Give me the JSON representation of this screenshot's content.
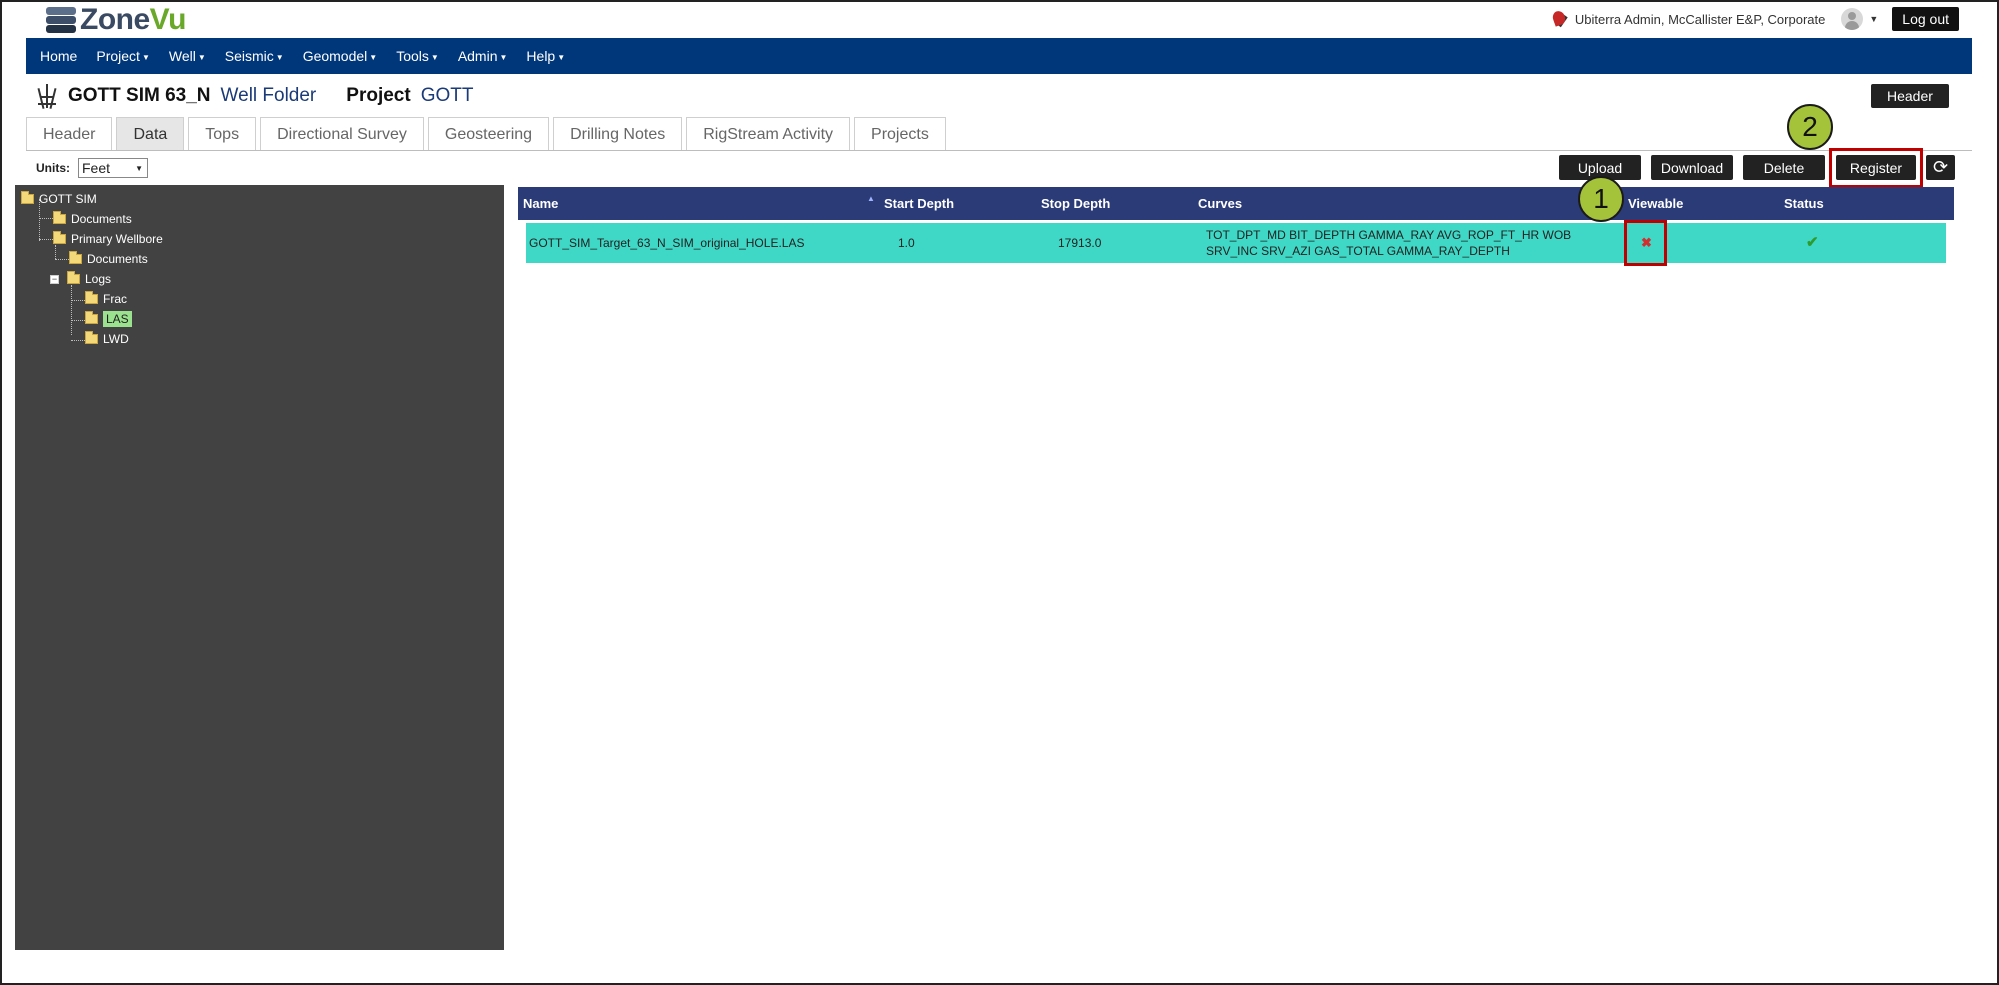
{
  "app": {
    "logo_zone": "Zone",
    "logo_vu": "Vu"
  },
  "user": {
    "name": "Ubiterra Admin, McCallister E&P, Corporate",
    "logout_label": "Log out"
  },
  "nav": {
    "items": [
      {
        "label": "Home",
        "dropdown": false
      },
      {
        "label": "Project",
        "dropdown": true
      },
      {
        "label": "Well",
        "dropdown": true
      },
      {
        "label": "Seismic",
        "dropdown": true
      },
      {
        "label": "Geomodel",
        "dropdown": true
      },
      {
        "label": "Tools",
        "dropdown": true
      },
      {
        "label": "Admin",
        "dropdown": true
      },
      {
        "label": "Help",
        "dropdown": true
      }
    ]
  },
  "title": {
    "well_name": "GOTT SIM 63_N",
    "well_folder": "Well Folder",
    "project_label": "Project",
    "project_name": "GOTT",
    "header_button": "Header"
  },
  "tabs": [
    {
      "label": "Header",
      "active": false
    },
    {
      "label": "Data",
      "active": true
    },
    {
      "label": "Tops",
      "active": false
    },
    {
      "label": "Directional Survey",
      "active": false
    },
    {
      "label": "Geosteering",
      "active": false
    },
    {
      "label": "Drilling Notes",
      "active": false
    },
    {
      "label": "RigStream Activity",
      "active": false
    },
    {
      "label": "Projects",
      "active": false
    }
  ],
  "units": {
    "label": "Units:",
    "selected": "Feet"
  },
  "actions": {
    "upload": "Upload",
    "download": "Download",
    "delete": "Delete",
    "register": "Register",
    "refresh_icon": "refresh-icon"
  },
  "callouts": {
    "one": "1",
    "two": "2"
  },
  "tree": {
    "root": "GOTT SIM",
    "documents": "Documents",
    "primary_wellbore": "Primary Wellbore",
    "wb_documents": "Documents",
    "logs": "Logs",
    "frac": "Frac",
    "las": "LAS",
    "lwd": "LWD"
  },
  "table": {
    "columns": [
      "Name",
      "Start Depth",
      "Stop Depth",
      "Curves",
      "Viewable",
      "Status"
    ],
    "rows": [
      {
        "name": "GOTT_SIM_Target_63_N_SIM_original_HOLE.LAS",
        "start_depth": "1.0",
        "stop_depth": "17913.0",
        "curves_line1": "TOT_DPT_MD BIT_DEPTH GAMMA_RAY AVG_ROP_FT_HR WOB",
        "curves_line2": "SRV_INC SRV_AZI GAS_TOTAL GAMMA_RAY_DEPTH",
        "viewable": "✖",
        "status": "✔"
      }
    ]
  },
  "colors": {
    "nav_bg": "#00367a",
    "table_header_bg": "#2b3b78",
    "row_highlight": "#3fd8c6",
    "tree_bg": "#424242",
    "callout_fill": "#a4c23a",
    "highlight_box": "#c00000"
  }
}
